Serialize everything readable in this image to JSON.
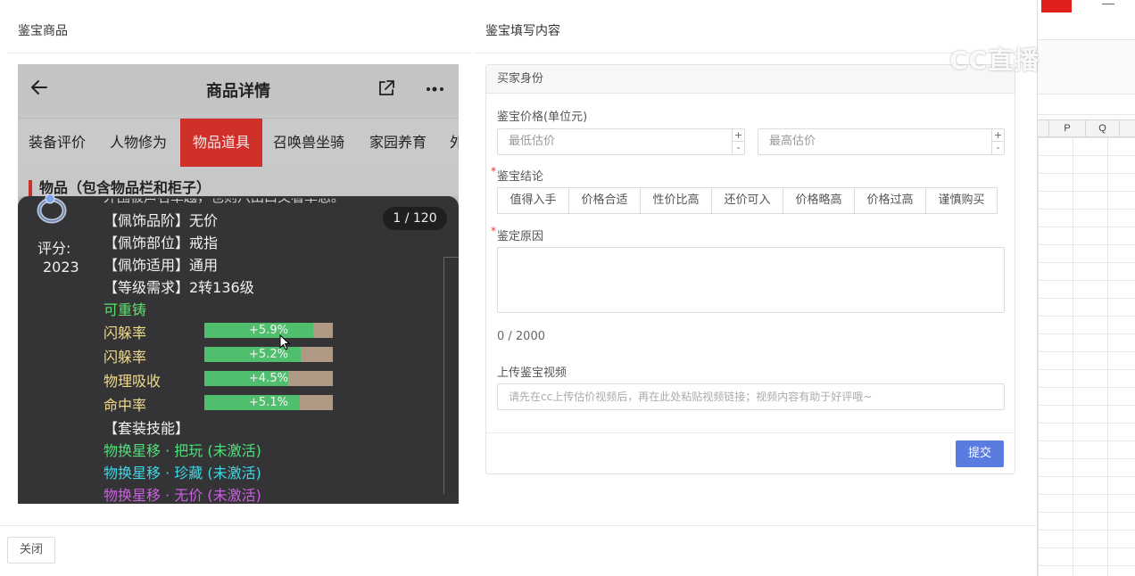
{
  "modal": {
    "left_title": "鉴宝商品",
    "right_title": "鉴宝填写内容",
    "close_label": "关闭"
  },
  "phone": {
    "title": "商品详情",
    "tabs": [
      "装备评价",
      "人物修为",
      "物品道具",
      "召唤兽坐骑",
      "家园养育",
      "外"
    ],
    "active_tab": "物品道具",
    "section_title": "物品（包含物品栏和柜子）",
    "overlay": {
      "cut_line": "外围被声名卓越，也则八田口又看卓忍。",
      "score_label": "评分:",
      "score_value": "2023",
      "page_counter": "1 / 120",
      "attributes": [
        "【佩饰品阶】无价",
        "【佩饰部位】戒指",
        "【佩饰适用】通用",
        "【等级需求】2转136级"
      ],
      "recastable": "可重铸",
      "stats": [
        {
          "name": "闪躲率",
          "value": "+5.9%",
          "fill": 0.85
        },
        {
          "name": "闪躲率",
          "value": "+5.2%",
          "fill": 0.75
        },
        {
          "name": "物理吸收",
          "value": "+4.5%",
          "fill": 0.65
        },
        {
          "name": "命中率",
          "value": "+5.1%",
          "fill": 0.74
        }
      ],
      "set_skill_title": "【套装技能】",
      "set_skills": [
        {
          "text": "物换星移 · 把玩 (未激活)",
          "color": "#4fe07a"
        },
        {
          "text": "物换星移 · 珍藏 (未激活)",
          "color": "#3fd6e6"
        },
        {
          "text": "物换星移 · 无价 (未激活)",
          "color": "#c95fe0"
        }
      ]
    }
  },
  "form": {
    "section_header": "买家身份",
    "price_label": "鉴宝价格(单位元)",
    "min_placeholder": "最低估价",
    "max_placeholder": "最高估价",
    "conclusion_label": "鉴宝结论",
    "conclusion_options": [
      "值得入手",
      "价格合适",
      "性价比高",
      "还价可入",
      "价格略高",
      "价格过高",
      "谨慎购买"
    ],
    "reason_label": "鉴定原因",
    "char_counter": "0 / 2000",
    "video_label": "上传鉴宝视频",
    "video_placeholder": "请先在cc上传估价视频后，再在此处粘贴视频链接；视频内容有助于好评哦~",
    "submit_label": "提交",
    "stepper_plus": "+",
    "stepper_minus": "-"
  },
  "sheet": {
    "columns": [
      "P",
      "Q"
    ],
    "accent": "#e0201c"
  },
  "watermark": "CC直播"
}
